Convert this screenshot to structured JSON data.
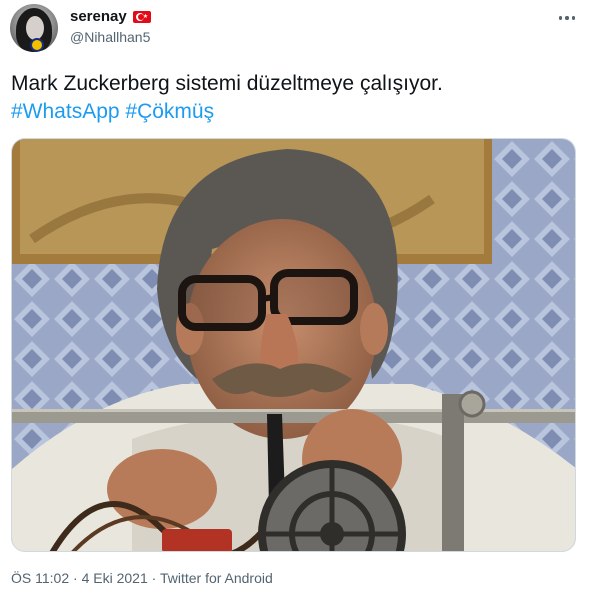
{
  "user": {
    "display_name": "serenay",
    "handle": "@Nihallhan5",
    "flag_icon": "turkey-flag-icon"
  },
  "tweet": {
    "text": "Mark Zuckerberg sistemi düzeltmeye çalışıyor.",
    "hashtags": [
      "#WhatsApp",
      "#Çökmüş"
    ],
    "link_color": "#1d9bf0"
  },
  "media": {
    "type": "photo",
    "icon": "photo-image"
  },
  "meta": {
    "time": "ÖS 11:02",
    "date": "4 Eki 2021",
    "source": "Twitter for Android",
    "separator": "·"
  }
}
